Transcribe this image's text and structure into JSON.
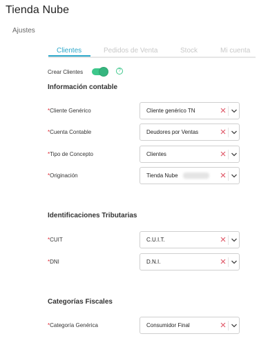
{
  "app": {
    "title": "Tienda Nube"
  },
  "breadcrumb": "Ajustes",
  "tabs": [
    {
      "label": "Clientes",
      "active": true
    },
    {
      "label": "Pedidos de Venta",
      "active": false
    },
    {
      "label": "Stock",
      "active": false
    },
    {
      "label": "Mi cuenta",
      "active": false
    }
  ],
  "toggle": {
    "label": "Crear Clientes",
    "enabled": true
  },
  "sections": {
    "contable": {
      "title": "Información contable",
      "fields": [
        {
          "label": "Cliente Genérico",
          "required_mark": "*",
          "value": "Cliente genérico TN"
        },
        {
          "label": "Cuenta Contable",
          "required_mark": "*",
          "value": "Deudores por Ventas"
        },
        {
          "label": "Tipo de Concepto",
          "required_mark": "*",
          "value": "Clientes"
        },
        {
          "label": "Originación",
          "required_mark": "*",
          "value": "Tienda Nube"
        }
      ]
    },
    "tributarias": {
      "title": "Identificaciones Tributarias",
      "fields": [
        {
          "label": "CUIT",
          "required_mark": "*",
          "value": "C.U.I.T."
        },
        {
          "label": "DNI",
          "required_mark": "*",
          "value": "D.N.I."
        }
      ]
    },
    "fiscales": {
      "title": "Categorías Fiscales",
      "fields": [
        {
          "label": "Categoría Genérica",
          "required_mark": "*",
          "value": "Consumidor Final"
        }
      ]
    }
  },
  "colors": {
    "accent": "#2aa6c9",
    "toggle_on": "#3ec78b",
    "required": "#e0232f",
    "clear_icon": "#e05a6a"
  },
  "icons": {
    "help": "question-circle-icon",
    "clear": "close-x-icon",
    "dropdown": "chevron-down-icon"
  }
}
